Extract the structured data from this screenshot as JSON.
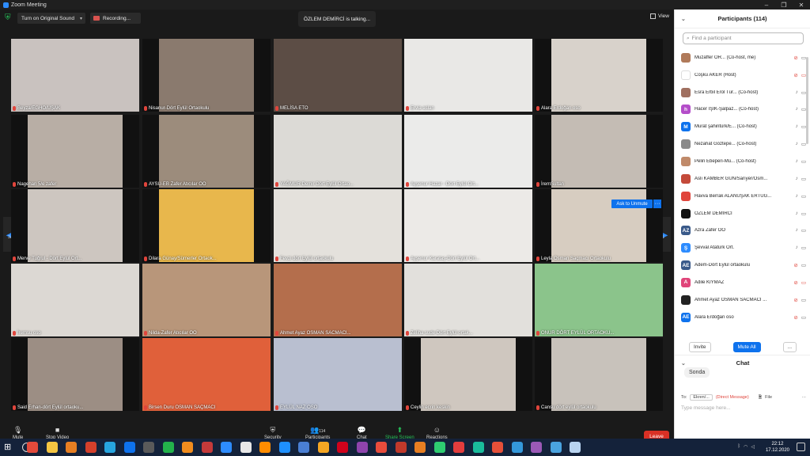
{
  "window": {
    "title": "Zoom Meeting",
    "controls": [
      "–",
      "❐",
      "✕"
    ]
  },
  "topbar": {
    "sound_label": "Turn on Original Sound",
    "recording_label": "Recording...",
    "talking_label": "ÖZLEM DEMİRCİ is talking...",
    "view_label": "View"
  },
  "gallery": {
    "page_left": "3/5",
    "page_right": "3/5",
    "ask_unmute": "Ask to Unmute",
    "more": "···",
    "tiles": [
      {
        "name": "Beyza/EGHO/UŞAK",
        "bg": "#c9c2bf"
      },
      {
        "name": "Nisanur-Dört Eylül Ortaokulu",
        "bg": "#8a7a6e"
      },
      {
        "name": "MELİSA ETO",
        "bg": "#5c4d45"
      },
      {
        "name": "Ervia aslan",
        "bg": "#e9e8e6"
      },
      {
        "name": "Alara Erdoğan oso",
        "bg": "#d8d2cb"
      },
      {
        "name": "Nagehan 5/e zafer",
        "bg": "#b8aea5"
      },
      {
        "name": "AYSU-EB Zafer Atıcılar OO",
        "bg": "#9c8c7c"
      },
      {
        "name": "YAĞMUR Demir Dört Eylül Ortao...",
        "bg": "#dcdad6"
      },
      {
        "name": "Ayşenur Hazar - Dört Eylül Ort...",
        "bg": "#ebebea"
      },
      {
        "name": "İremSultan",
        "bg": "#c4bcb4"
      },
      {
        "name": "Merve Tuğrul - Dört Eylül Ort...",
        "bg": "#cdc6c0"
      },
      {
        "name": "Dilara Günay/Sümerler Ortaok...",
        "bg": "#e8b74c"
      },
      {
        "name": "Fevzi dört Eylül ortaokulu",
        "bg": "#e4e1dc"
      },
      {
        "name": "Ayşenur Karataş-Dört Eylül Ort...",
        "bg": "#eceae7"
      },
      {
        "name": "Leyla Osman Saçmacı Ortaokulu",
        "bg": "#d7cdc1"
      },
      {
        "name": "İremsu oso",
        "bg": "#dcd8d3"
      },
      {
        "name": "Nilda-Zafer Atıcılar OO",
        "bg": "#b8967a"
      },
      {
        "name": "Ahmet Ayaz OSMAN SACMACI...",
        "bg": "#b46e4c"
      },
      {
        "name": "Zeliha sude Dört Eylül ortak...",
        "bg": "#e2e0dc"
      },
      {
        "name": "ONUR DÖRT EYLÜL ORTAOKU...",
        "bg": "#8bc48b"
      },
      {
        "name": "Said Erhan-dört Eylül ortaoku...",
        "bg": "#9c8e84"
      },
      {
        "name": "Birsen Duru OSMAN SAÇMACI",
        "bg": "#e0603a"
      },
      {
        "name": "EYLÜL NAZ OSO",
        "bg": "#b9bfd0"
      },
      {
        "name": "Ceylin ecrin keskin",
        "bg": "#cfc7bf"
      },
      {
        "name": "Cansu dört eylül ortaokulu",
        "bg": "#c8c2bb"
      }
    ]
  },
  "toolbar": {
    "mute": "Mute",
    "stop_video": "Stop Video",
    "security": "Security",
    "participants": "Participants",
    "participants_count": "114",
    "chat": "Chat",
    "share_screen": "Share Screen",
    "reactions": "Reactions",
    "leave": "Leave"
  },
  "participants_panel": {
    "title": "Participants (114)",
    "search_placeholder": "Find a participant",
    "invite": "Invite",
    "mute_all": "Mute All",
    "more": "...",
    "list": [
      {
        "name": "Muzaffer OR... (Co-host, me)",
        "avatar": "",
        "color": "#b07a5a",
        "muted": true,
        "video_off": false
      },
      {
        "name": "Coşku AKER (Host)",
        "avatar": "",
        "color": "#ffffff",
        "muted": true,
        "video_off": true
      },
      {
        "name": "Esra Erbil Erol Tür... (Co-host)",
        "avatar": "",
        "color": "#a07060",
        "muted": false,
        "video_off": false
      },
      {
        "name": "Hacer IŞIK-Şalpaz... (Co-host)",
        "avatar": "h",
        "color": "#b44ec9",
        "muted": false,
        "video_off": false
      },
      {
        "name": "Murat şahintürk/E... (Co-host)",
        "avatar": "M",
        "color": "#0e72ed",
        "muted": false,
        "video_off": false
      },
      {
        "name": "Nezahat Göztepe... (Co-host)",
        "avatar": "",
        "color": "#8a8a8a",
        "muted": false,
        "video_off": false
      },
      {
        "name": "Pelin Ebeperi-Mü... (Co-host)",
        "avatar": "",
        "color": "#c08a6a",
        "muted": false,
        "video_off": false
      },
      {
        "name": "Aslı KAMBER GÜN/Sarıyer/Osm...",
        "avatar": "",
        "color": "#c44a3a",
        "muted": false,
        "video_off": false
      },
      {
        "name": "Havva Berrak ALANUŞAK ERTUĞ...",
        "avatar": "",
        "color": "#e0453c",
        "muted": false,
        "video_off": false
      },
      {
        "name": "ÖZLEM DEMİRCİ",
        "avatar": "",
        "color": "#111111",
        "muted": false,
        "video_off": false
      },
      {
        "name": "Azra Zafer OO",
        "avatar": "AZ",
        "color": "#3a5a8a",
        "muted": false,
        "video_off": false
      },
      {
        "name": "Şevval Atatürk Ort.",
        "avatar": "Ş",
        "color": "#2d8cff",
        "muted": false,
        "video_off": false
      },
      {
        "name": "Adem-Dört Eylül ortaokulu",
        "avatar": "AE",
        "color": "#3a5a8a",
        "muted": true,
        "video_off": false
      },
      {
        "name": "Adile KIYMAZ",
        "avatar": "A",
        "color": "#e0457a",
        "muted": true,
        "video_off": true
      },
      {
        "name": "Ahmet Ayaz OSMAN SACMACI ...",
        "avatar": "",
        "color": "#222222",
        "muted": true,
        "video_off": false
      },
      {
        "name": "Alara Erdoğan oso",
        "avatar": "AE",
        "color": "#0e72ed",
        "muted": true,
        "video_off": false
      }
    ]
  },
  "chat_panel": {
    "title": "Chat",
    "message": "Sonda",
    "to_label": "To:",
    "to_value": "Ekren/...",
    "direct_message": "(Direct Message)",
    "file_label": "File",
    "input_placeholder": "Type message here..."
  },
  "taskbar": {
    "time": "22:12",
    "date": "17.12.2020",
    "apps": [
      "#e24a3b",
      "#f4c542",
      "#e67e22",
      "#d4402b",
      "#27a5e0",
      "#0e72ed",
      "#5a5a5a",
      "#23b24b",
      "#f08c1e",
      "#c43a3a",
      "#2d8cff",
      "#e8e8e8",
      "#ff8c00",
      "#1e90ff",
      "#4a7fd4",
      "#f5a623",
      "#d0021b",
      "#8e44ad",
      "#e74c3c",
      "#c0392b",
      "#e67e22",
      "#2ecc71",
      "#e33d3d",
      "#1abc9c",
      "#e55039",
      "#3498db",
      "#9b59b6",
      "#4aa3df",
      "#b9d4f0"
    ]
  }
}
